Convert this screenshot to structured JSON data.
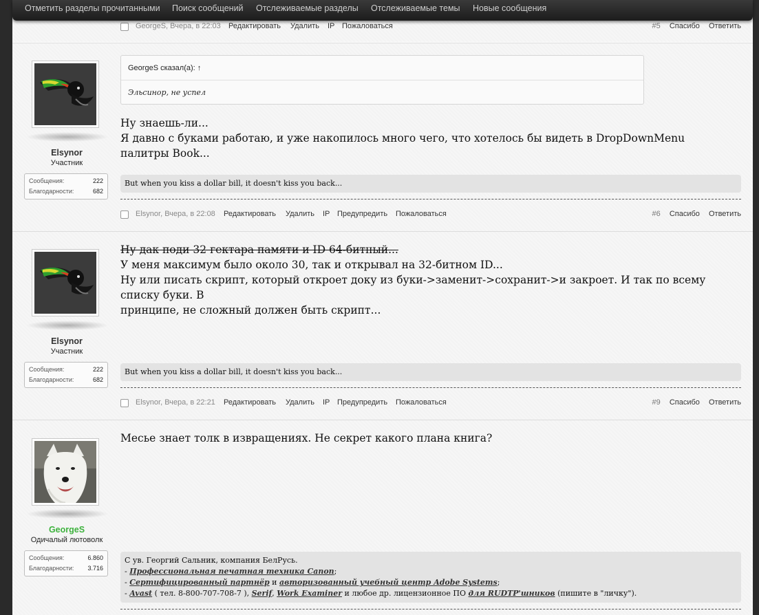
{
  "nav": {
    "items": [
      {
        "label": "Отметить разделы прочитанными"
      },
      {
        "label": "Поиск сообщений"
      },
      {
        "label": "Отслеживаемые разделы"
      },
      {
        "label": "Отслеживаемые темы"
      },
      {
        "label": "Новые сообщения"
      }
    ]
  },
  "post0": {
    "meta": {
      "author": "GeorgeS",
      "time": "Вчера, в 22:03",
      "edit": "Редактировать",
      "delete": "Удалить",
      "ip": "IP",
      "report": "Пожаловаться",
      "number": "#5",
      "thanks": "Спасибо",
      "reply": "Ответить"
    }
  },
  "post1": {
    "username": "Elsynor",
    "usertitle": "Участник",
    "stats": {
      "posts_label": "Сообщения:",
      "posts": "222",
      "thanks_label": "Благодарности:",
      "thanks": "682"
    },
    "quote": {
      "author_line": "GeorgeS сказал(а): ↑",
      "text": "Эльсинор, не успел"
    },
    "lines": [
      "Ну знаешь-ли...",
      "Я давно с буками работаю, и уже накопилось много чего, что хотелось бы видеть в DropDownMenu палитры Book..."
    ],
    "signature": "But when you kiss a dollar bill, it doesn't kiss you back...",
    "meta": {
      "author": "Elsynor",
      "time": "Вчера, в 22:08",
      "edit": "Редактировать",
      "delete": "Удалить",
      "ip": "IP",
      "warn": "Предупредить",
      "report": "Пожаловаться",
      "number": "#6",
      "thanks": "Спасибо",
      "reply": "Ответить"
    }
  },
  "post2": {
    "username": "Elsynor",
    "usertitle": "Участник",
    "stats": {
      "posts_label": "Сообщения:",
      "posts": "222",
      "thanks_label": "Благодарности:",
      "thanks": "682"
    },
    "lines": [
      "Ну дак поди 32 гектара памяти и ID 64-битный...",
      "У меня максимум было около 30, так и открывал на 32-битном ID...",
      "Ну или писать скрипт, который откроет доку из буки->заменит->сохранит->и закроет. И так по всему списку буки. В",
      "принципе, не сложный должен быть скрипт..."
    ],
    "signature": "But when you kiss a dollar bill, it doesn't kiss you back...",
    "meta": {
      "author": "Elsynor",
      "time": "Вчера, в 22:21",
      "edit": "Редактировать",
      "delete": "Удалить",
      "ip": "IP",
      "warn": "Предупредить",
      "report": "Пожаловаться",
      "number": "#9",
      "thanks": "Спасибо",
      "reply": "Ответить"
    }
  },
  "post3": {
    "username": "GeorgeS",
    "usertitle": "Одичалый лютоволк",
    "stats": {
      "posts_label": "Сообщения:",
      "posts": "6.860",
      "thanks_label": "Благодарности:",
      "thanks": "3.716"
    },
    "lines": [
      "Месье знает толк в извращениях. Не секрет какого плана книга?"
    ],
    "signature": {
      "line1": "С ув. Георгий Сальник, компания БелРусь.",
      "l2_prefix": "- ",
      "l2_link": "Профессиональная печатная техника Canon",
      "l2_suffix": ";",
      "l3_prefix": "- ",
      "l3_link1": "Сертифицированный партнёр",
      "l3_mid": " и ",
      "l3_link2": "авторизованный учебный центр Adobe Systems",
      "l3_suffix": ";",
      "l4_prefix": "- ",
      "l4_link1": "Avast",
      "l4_mid1": " ( тел. 8-800-707-708-7 ), ",
      "l4_link2": "Serif",
      "l4_mid2": ", ",
      "l4_link3": "Work Examiner",
      "l4_mid3": " и любое др. лицензионное ПО ",
      "l4_link4": "для RUDTP'шников",
      "l4_suffix": " (пишите в \"личку\")."
    }
  }
}
